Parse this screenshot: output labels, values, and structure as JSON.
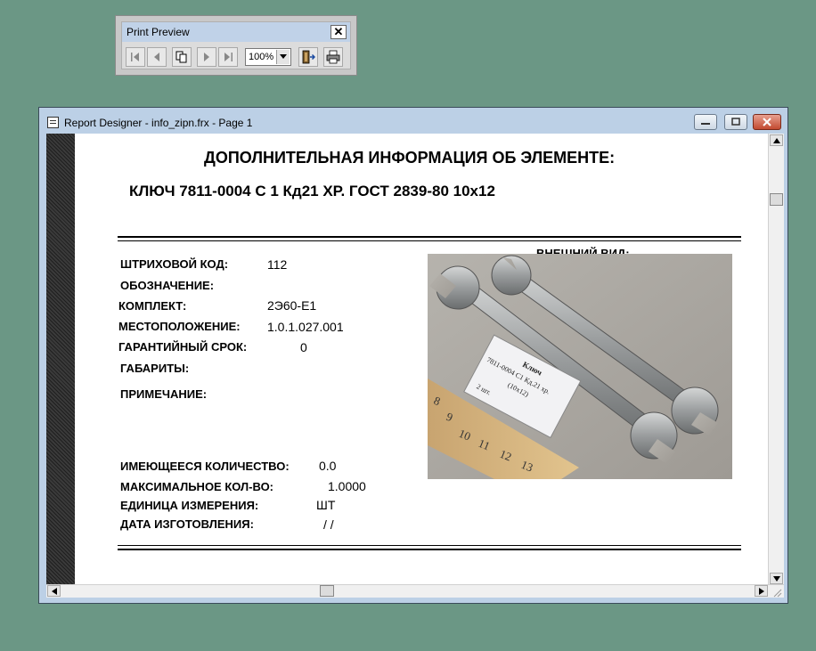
{
  "print_preview": {
    "title": "Print Preview",
    "close_symbol": "✕",
    "zoom": "100%",
    "buttons": [
      "first-page",
      "previous-page",
      "multi-page",
      "next-page",
      "last-page",
      "close-preview",
      "print"
    ]
  },
  "window": {
    "title": "Report Designer - info_zipn.frx - Page 1"
  },
  "report": {
    "header": "ДОПОЛНИТЕЛЬНАЯ ИНФОРМАЦИЯ ОБ ЭЛЕМЕНТЕ:",
    "item_name": "КЛЮЧ 7811-0004 С 1 Кд21 ХР. ГОСТ 2839-80 10x12",
    "appearance_label": "ВНЕШНИЙ ВИД:",
    "fields": {
      "barcode_label": "ШТРИХОВОЙ КОД:",
      "barcode_value": "112",
      "designation_label": "ОБОЗНАЧЕНИЕ:",
      "designation_value": "",
      "kit_label": "КОМПЛЕКТ:",
      "kit_value": "2Э60-Е1",
      "location_label": "МЕСТОПОЛОЖЕНИЕ:",
      "location_value": "1.0.1.027.001",
      "warranty_label": "ГАРАНТИЙНЫЙ СРОК:",
      "warranty_value": "0",
      "dimensions_label": "ГАБАРИТЫ:",
      "dimensions_value": "",
      "note_label": "ПРИМЕЧАНИЕ:",
      "note_value": "",
      "qty_label": "ИМЕЮЩЕЕСЯ КОЛИЧЕСТВО:",
      "qty_value": "0.0",
      "max_qty_label": "МАКСИМАЛЬНОЕ КОЛ-ВО:",
      "max_qty_value": "1.0000",
      "unit_label": "ЕДИНИЦА ИЗМЕРЕНИЯ:",
      "unit_value": "ШТ",
      "mfg_date_label": "ДАТА ИЗГОТОВЛЕНИЯ:",
      "mfg_date_value": "/ /"
    },
    "photo_tag": {
      "line1": "Ключ",
      "line2": "7811-0004 С1 Кд.21 хр.",
      "line3": "(10х12)",
      "line4": "2 шт."
    },
    "ruler_numbers": [
      "8",
      "9",
      "10",
      "11",
      "12",
      "13"
    ]
  },
  "colors": {
    "desktop": "#6b9785",
    "window_frame": "#bcd0e6",
    "close_button": "#c24a30"
  }
}
